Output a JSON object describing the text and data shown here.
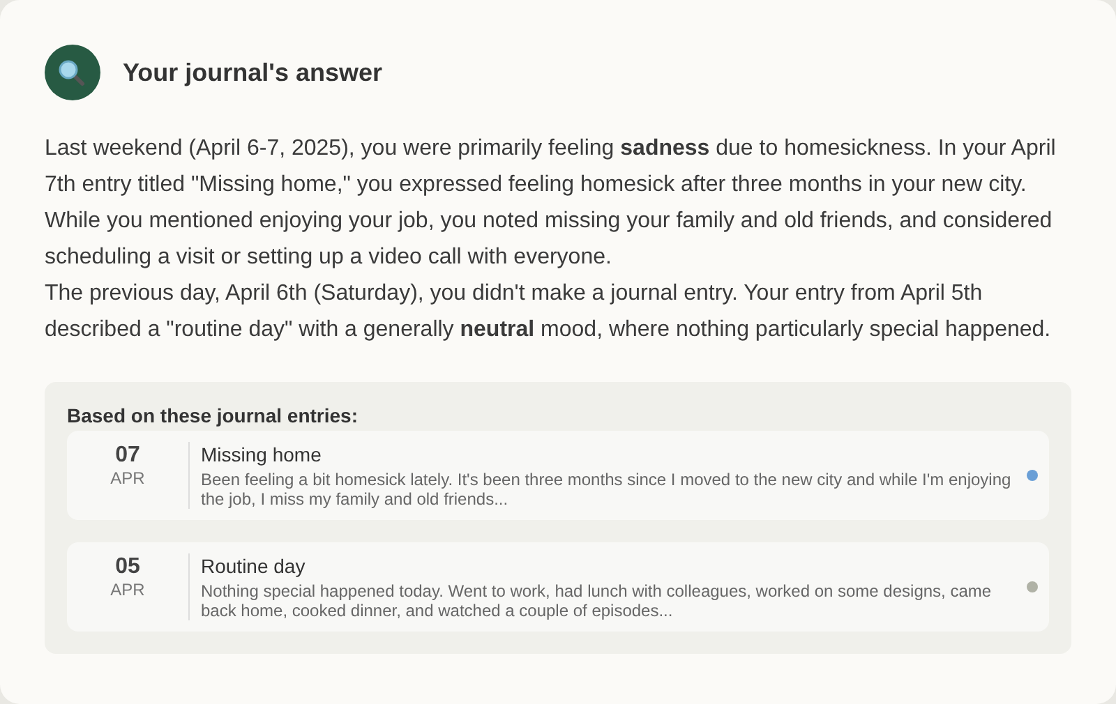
{
  "header": {
    "title": "Your journal's answer"
  },
  "answer": [
    "Last weekend (April 6-7, 2025), you were primarily feeling **sadness** due to homesickness. In your April 7th entry titled \"Missing home,\" you expressed feeling homesick after three months in your new city. While you mentioned enjoying your job, you noted missing your family and old friends, and considered scheduling a visit or setting up a video call with everyone.",
    "The previous day, April 6th (Saturday), you didn't make a journal entry. Your entry from April 5th described a \"routine day\" with a generally **neutral** mood, where nothing particularly special happened."
  ],
  "sources": {
    "heading": "Based on these journal entries:",
    "entries": [
      {
        "day": "07",
        "month": "APR",
        "title": "Missing home",
        "excerpt": "Been feeling a bit homesick lately. It's been three months since I moved to the new city and while I'm enjoying the job, I miss my family and old friends...",
        "color": "#6a9fd6"
      },
      {
        "day": "05",
        "month": "APR",
        "title": "Routine day",
        "excerpt": "Nothing special happened today. Went to work, had lunch with colleagues, worked on some designs, came back home, cooked dinner, and watched a couple of episodes...",
        "color": "#b0b2a6"
      }
    ]
  }
}
